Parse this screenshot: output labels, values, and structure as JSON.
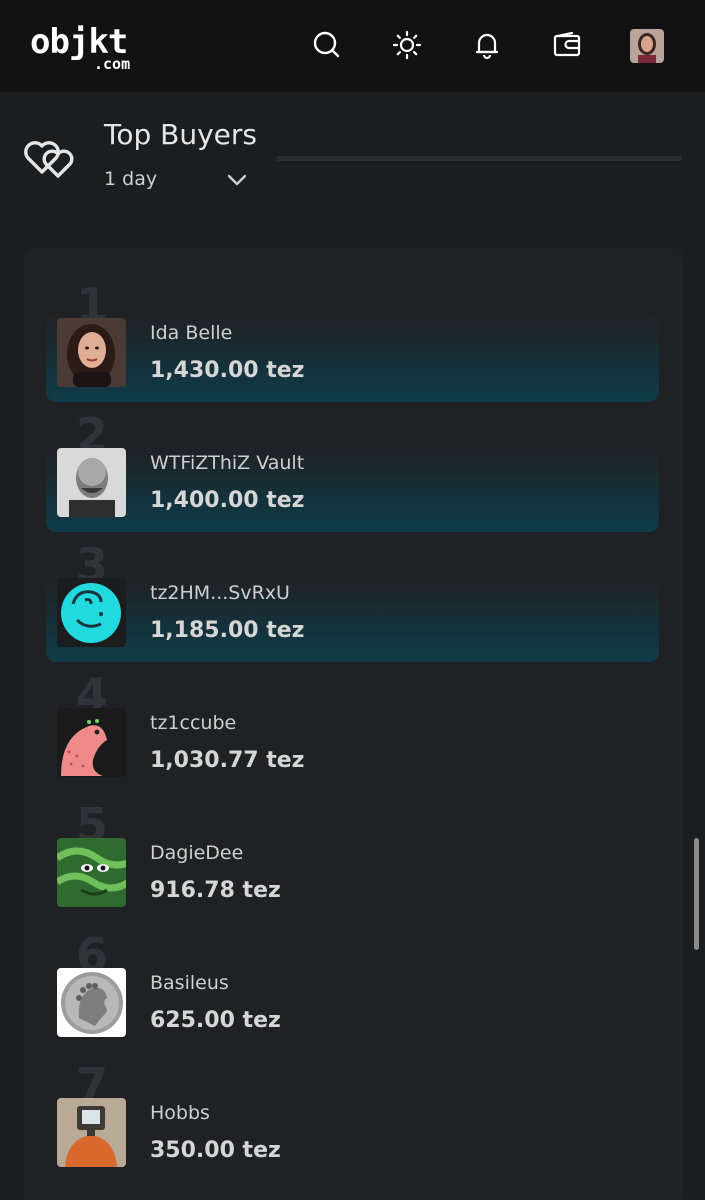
{
  "header": {
    "logo_main": "objkt",
    "logo_sub": ".com",
    "icons": [
      "search-icon",
      "theme-sun-icon",
      "bell-icon",
      "wallet-icon"
    ],
    "background": "#121212"
  },
  "section": {
    "title": "Top Buyers",
    "period": "1 day",
    "icon": "hearts-icon"
  },
  "buyers": [
    {
      "rank": "1",
      "name": "Ida Belle",
      "amount": "1,430.00 tez"
    },
    {
      "rank": "2",
      "name": "WTFiZThiZ Vault",
      "amount": "1,400.00 tez"
    },
    {
      "rank": "3",
      "name": "tz2HM...SvRxU",
      "amount": "1,185.00 tez"
    },
    {
      "rank": "4",
      "name": "tz1ccube",
      "amount": "1,030.77 tez"
    },
    {
      "rank": "5",
      "name": "DagieDee",
      "amount": "916.78 tez"
    },
    {
      "rank": "6",
      "name": "Basileus",
      "amount": "625.00 tez"
    },
    {
      "rank": "7",
      "name": "Hobbs",
      "amount": "350.00 tez"
    }
  ],
  "colors": {
    "page_bg": "#1c1d1f",
    "panel_bg": "#202124",
    "highlight": "#0f3c49",
    "accent_cyan": "#22d9e0"
  }
}
